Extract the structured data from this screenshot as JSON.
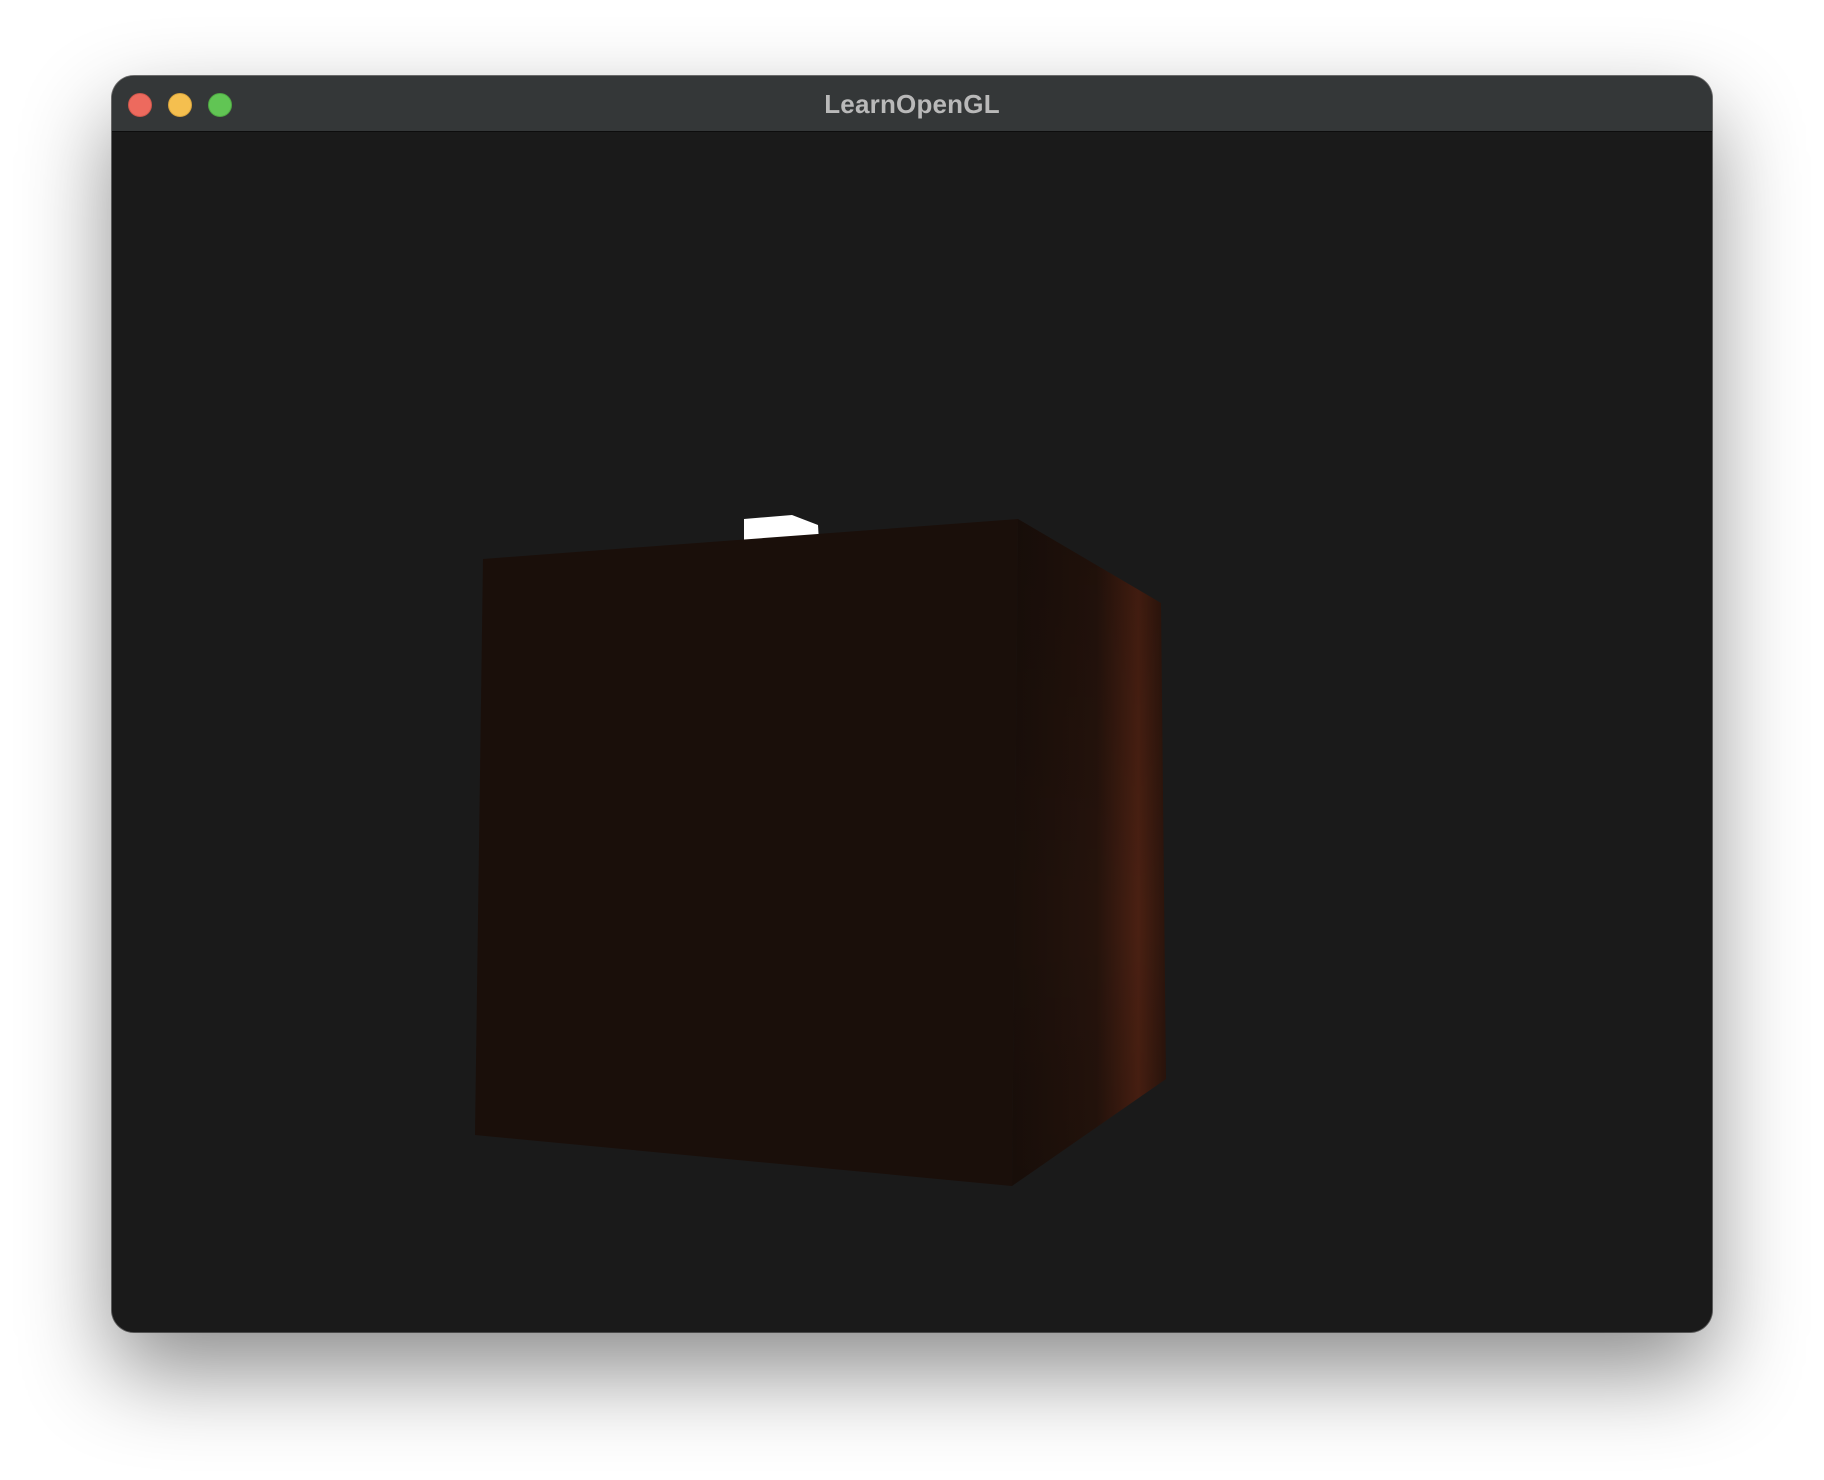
{
  "window": {
    "title": "LearnOpenGL"
  },
  "titlebar_buttons": [
    {
      "name": "close",
      "color": "#ed6a5e"
    },
    {
      "name": "minimize",
      "color": "#f5bf4f"
    },
    {
      "name": "zoom",
      "color": "#61c554"
    }
  ],
  "scene": {
    "background_color": "#1a1a1a",
    "cube_front_color": "#1a0f0a",
    "cube_side_highlight_color": "#4a2012",
    "light_cube_color": "#ffffff"
  }
}
